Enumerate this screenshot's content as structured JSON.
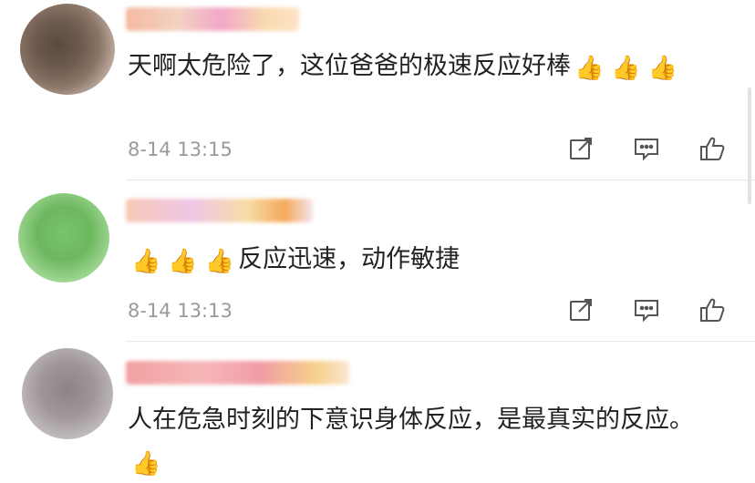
{
  "comments": [
    {
      "text_main": "天啊太危险了，这位爸爸的极速反应好棒",
      "emoji": [
        "👍",
        "👍",
        "👍"
      ],
      "timestamp": "8-14 13:15"
    },
    {
      "emoji": [
        "👍",
        "👍",
        "👍"
      ],
      "text_main": "反应迅速，动作敏捷",
      "timestamp": "8-14 13:13"
    },
    {
      "text_main": "人在危急时刻的下意识身体反应，是最真实的反应。",
      "emoji": [
        "👍"
      ]
    }
  ],
  "icons": {
    "share": "share-icon",
    "comment": "comment-icon",
    "like": "like-icon"
  },
  "colors": {
    "text": "#222222",
    "timestamp": "#9a9a9a",
    "icon": "#555555",
    "divider": "#e6e6e6"
  }
}
